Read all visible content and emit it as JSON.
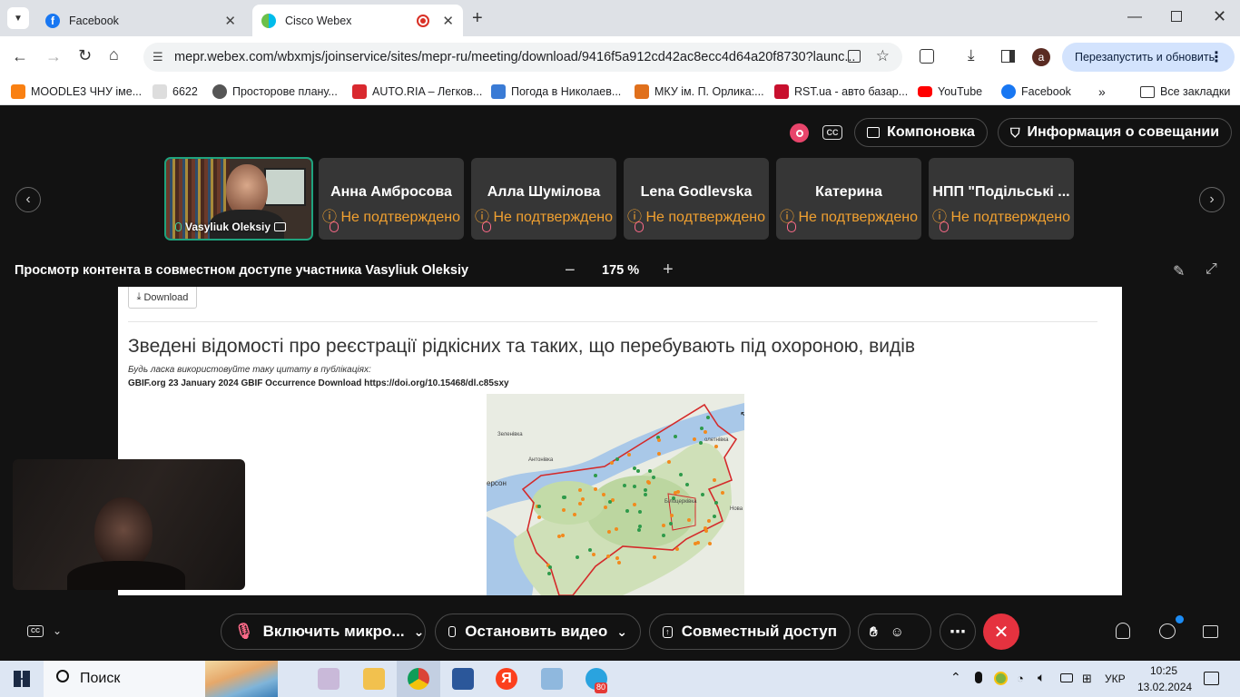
{
  "browser": {
    "tabs": [
      {
        "label": "Facebook",
        "icon": "facebook-icon"
      },
      {
        "label": "Cisco Webex",
        "icon": "webex-icon"
      }
    ],
    "url": "mepr.webex.com/wbxmjs/joinservice/sites/mepr-ru/meeting/download/9416f5a912cd42ac8ecc4d64a20f8730?launc...",
    "relaunch_label": "Перезапустить и обновить",
    "profile_letter": "a",
    "bookmarks": [
      "MOODLE3 ЧНУ іме...",
      "6622",
      "Просторове плану...",
      "AUTO.RIA – Легков...",
      "Погода в Николаев...",
      "МКУ ім. П. Орлика:...",
      "RST.ua - авто базар...",
      "YouTube",
      "Facebook"
    ],
    "all_bookmarks_label": "Все закладки"
  },
  "webex": {
    "layout_label": "Компоновка",
    "meeting_info_label": "Информация о совещании",
    "presenter": {
      "name": "Vasyliuk Oleksiy"
    },
    "participants": [
      {
        "name": "Анна Амбросова",
        "status": "Не подтверждено"
      },
      {
        "name": "Алла Шумілова",
        "status": "Не подтверждено"
      },
      {
        "name": "Lena Godlevska",
        "status": "Не подтверждено"
      },
      {
        "name": "Катерина",
        "status": "Не подтверждено"
      },
      {
        "name": "НПП \"Подільські ...",
        "status": "Не подтверждено"
      }
    ],
    "share_title": "Просмотр контента в совместном доступе участника Vasyliuk Oleksiy",
    "zoom": "175 %",
    "controls": {
      "mute": "Включить микро...",
      "video": "Остановить видео",
      "share": "Совместный доступ"
    }
  },
  "shared_page": {
    "download_label": "Download",
    "heading": "Зведені відомості про реєстрації рідкісних та таких, що перебувають під охороною, видів",
    "cite_hint": "Будь ласка використовуйте таку цитату в публікаціях:",
    "citation": "GBIF.org 23 January 2024 GBIF Occurrence Download https://doi.org/10.15468/dl.c85sxy",
    "map_labels": [
      "Зеленівка",
      "Антонівка",
      "ерсон",
      "Нова",
      "олетнівка",
      "Білоцерківка"
    ]
  },
  "taskbar": {
    "search_label": "Поиск",
    "telegram_badge": "80",
    "lang": "УКР",
    "time": "10:25",
    "date": "13.02.2024"
  }
}
